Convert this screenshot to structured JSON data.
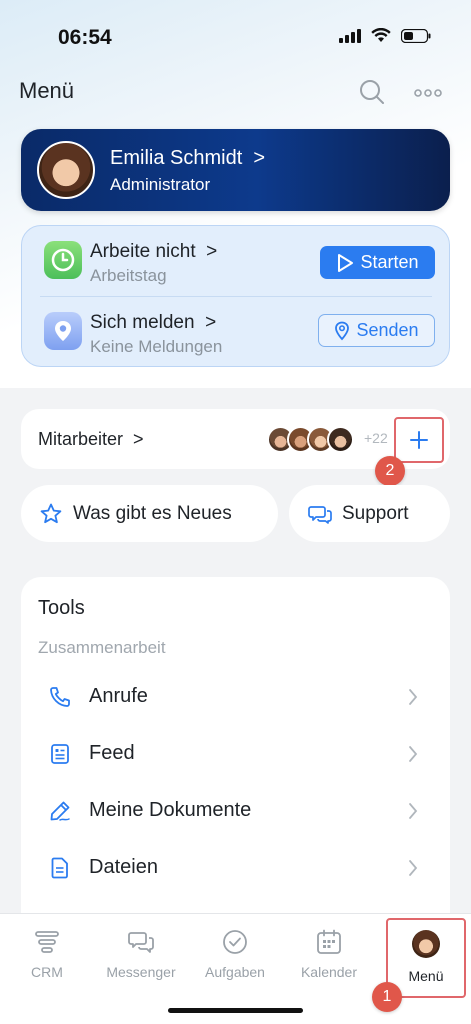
{
  "status_bar": {
    "time": "06:54"
  },
  "header": {
    "title": "Menü"
  },
  "profile": {
    "name": "Emilia Schmidt",
    "role": "Administrator"
  },
  "work": {
    "row1": {
      "title": "Arbeite nicht",
      "subtitle": "Arbeitstag",
      "button": "Starten"
    },
    "row2": {
      "title": "Sich melden",
      "subtitle": "Keine Meldungen",
      "button": "Senden"
    }
  },
  "staff": {
    "label": "Mitarbeiter",
    "more_count": "+22",
    "badge": "2"
  },
  "quick": {
    "news_label": "Was gibt es Neues",
    "support_label": "Support"
  },
  "tools": {
    "title": "Tools",
    "section": "Zusammenarbeit",
    "items": [
      {
        "label": "Anrufe",
        "icon": "phone-icon"
      },
      {
        "label": "Feed",
        "icon": "feed-icon"
      },
      {
        "label": "Meine Dokumente",
        "icon": "pen-icon"
      },
      {
        "label": "Dateien",
        "icon": "file-icon"
      }
    ]
  },
  "tabbar": {
    "tabs": [
      {
        "label": "CRM",
        "icon": "crm-icon"
      },
      {
        "label": "Messenger",
        "icon": "messenger-icon"
      },
      {
        "label": "Aufgaben",
        "icon": "check-icon"
      },
      {
        "label": "Kalender",
        "icon": "calendar-icon"
      },
      {
        "label": "Menü",
        "icon": "avatar"
      }
    ],
    "badge": "1"
  },
  "colors": {
    "accent": "#2b7cf0",
    "highlight": "#e0676b",
    "badge": "#e0574a",
    "profile_bg": "#0d3a8c"
  }
}
